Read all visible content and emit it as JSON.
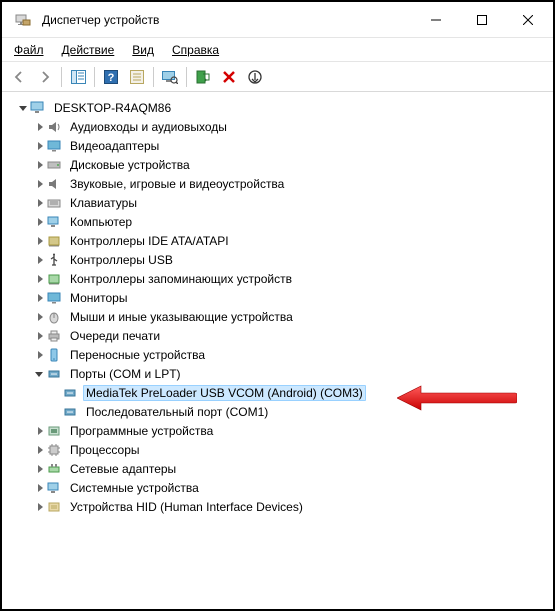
{
  "title": "Диспетчер устройств",
  "menus": {
    "file": "Файл",
    "action": "Действие",
    "view": "Вид",
    "help": "Справка"
  },
  "tree": {
    "root": "DESKTOP-R4AQM86",
    "items": [
      "Аудиовходы и аудиовыходы",
      "Видеоадаптеры",
      "Дисковые устройства",
      "Звуковые, игровые и видеоустройства",
      "Клавиатуры",
      "Компьютер",
      "Контроллеры IDE ATA/ATAPI",
      "Контроллеры USB",
      "Контроллеры запоминающих устройств",
      "Мониторы",
      "Мыши и иные указывающие устройства",
      "Очереди печати",
      "Переносные устройства"
    ],
    "ports": {
      "label": "Порты (COM и LPT)",
      "children": [
        "MediaTek PreLoader USB VCOM (Android) (COM3)",
        "Последовательный порт (COM1)"
      ]
    },
    "after": [
      "Программные устройства",
      "Процессоры",
      "Сетевые адаптеры",
      "Системные устройства",
      "Устройства HID (Human Interface Devices)"
    ]
  }
}
